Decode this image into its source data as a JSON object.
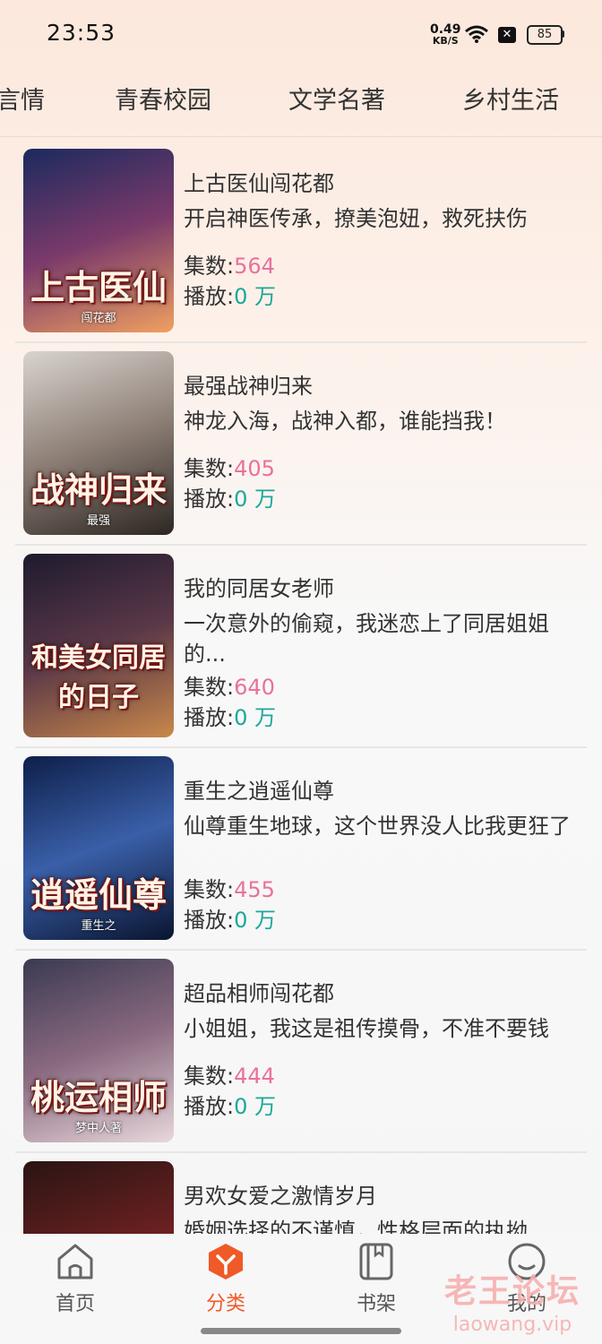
{
  "status_bar": {
    "time": "23:53",
    "net_speed_value": "0.49",
    "net_speed_unit": "KB/S",
    "x_badge": "✕",
    "battery": "85"
  },
  "category_tabs": [
    "言情",
    "青春校园",
    "文学名著",
    "乡村生活"
  ],
  "books": [
    {
      "title": "上古医仙闯花都",
      "description": "开启神医传承，撩美泡妞，救死扶伤",
      "episodes_label": "集数:",
      "episodes": "564",
      "plays_label": "播放:",
      "plays": "0 万",
      "cover_text": "上古医仙",
      "cover_subtext": "闯花都",
      "cover_colors": [
        "#1b2a5e",
        "#7a3a6a",
        "#f0a060"
      ]
    },
    {
      "title": "最强战神归来",
      "description": "神龙入海，战神入都，谁能挡我！",
      "episodes_label": "集数:",
      "episodes": "405",
      "plays_label": "播放:",
      "plays": "0 万",
      "cover_text": "战神归来",
      "cover_subtext": "最强",
      "cover_colors": [
        "#d9d4cf",
        "#8d7f76",
        "#2d2622"
      ]
    },
    {
      "title": "我的同居女老师",
      "description": "一次意外的偷窥，我迷恋上了同居姐姐的...",
      "episodes_label": "集数:",
      "episodes": "640",
      "plays_label": "播放:",
      "plays": "0 万",
      "cover_text": "和美女同居的日子",
      "cover_subtext": "",
      "cover_colors": [
        "#1e1a2e",
        "#5a3848",
        "#c9884a"
      ]
    },
    {
      "title": "重生之逍遥仙尊",
      "description": "仙尊重生地球，这个世界没人比我更狂了",
      "episodes_label": "集数:",
      "episodes": "455",
      "plays_label": "播放:",
      "plays": "0 万",
      "cover_text": "逍遥仙尊",
      "cover_subtext": "重生之",
      "cover_colors": [
        "#0e1f4a",
        "#3a5fa8",
        "#0a1530"
      ]
    },
    {
      "title": "超品相师闯花都",
      "description": "小姐姐，我这是祖传摸骨，不准不要钱",
      "episodes_label": "集数:",
      "episodes": "444",
      "plays_label": "播放:",
      "plays": "0 万",
      "cover_text": "桃运相师",
      "cover_subtext": "梦中人著",
      "cover_colors": [
        "#3a3a52",
        "#8a6a80",
        "#e8d8dc"
      ]
    },
    {
      "title": "男欢女爱之激情岁月",
      "description": "婚姻选择的不谨慎，性格层面的执拗",
      "episodes_label": "",
      "episodes": "",
      "plays_label": "",
      "plays": "",
      "cover_text": "",
      "cover_subtext": "",
      "cover_colors": [
        "#2a1414",
        "#6a2020",
        "#c84040"
      ]
    }
  ],
  "bottom_nav": [
    {
      "label": "首页",
      "icon": "home-icon"
    },
    {
      "label": "分类",
      "icon": "category-icon",
      "active": true
    },
    {
      "label": "书架",
      "icon": "bookshelf-icon"
    },
    {
      "label": "我的",
      "icon": "profile-icon"
    }
  ],
  "watermark": {
    "line1": "老王论坛",
    "line2": "laowang.vip"
  },
  "colors": {
    "accent": "#f05a28",
    "episodes": "#e9719b",
    "plays": "#1aa89a"
  }
}
